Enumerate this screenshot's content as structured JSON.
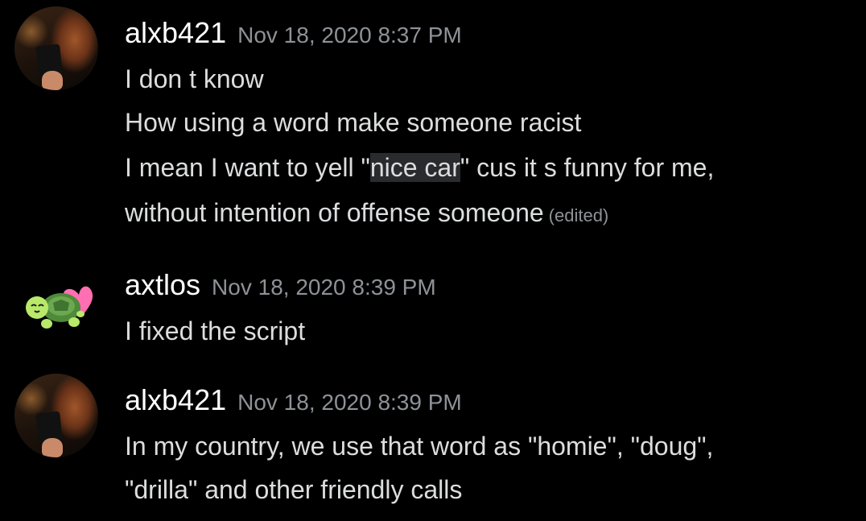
{
  "messages": [
    {
      "username": "alxb421",
      "timestamp": "Nov 18, 2020 8:37 PM",
      "lines": [
        {
          "text": "I don t know"
        },
        {
          "text": "How using a word make someone racist"
        },
        {
          "before": "I mean I want to yell \"",
          "highlight": "nice car",
          "after": "\" cus it s funny for me,"
        },
        {
          "text": "without intention of offense someone",
          "edited": "(edited)"
        }
      ]
    },
    {
      "username": "axtlos",
      "timestamp": "Nov 18, 2020 8:39 PM",
      "lines": [
        {
          "text": "I fixed the script"
        }
      ]
    },
    {
      "username": "alxb421",
      "timestamp": "Nov 18, 2020 8:39 PM",
      "lines": [
        {
          "text": "In my country, we use that word as \"homie\", \"doug\","
        },
        {
          "text": "\"drilla\" and other friendly calls"
        }
      ]
    }
  ],
  "colors": {
    "background": "#000000",
    "username": "#ffffff",
    "timestamp": "#8e9297",
    "message_text": "#dcddde",
    "highlight": "#2a2b2e"
  },
  "icons": {
    "avatar_1": "user-photo-avatar",
    "avatar_2": "turtle-heart-emoji-avatar",
    "avatar_3": "user-photo-avatar"
  }
}
